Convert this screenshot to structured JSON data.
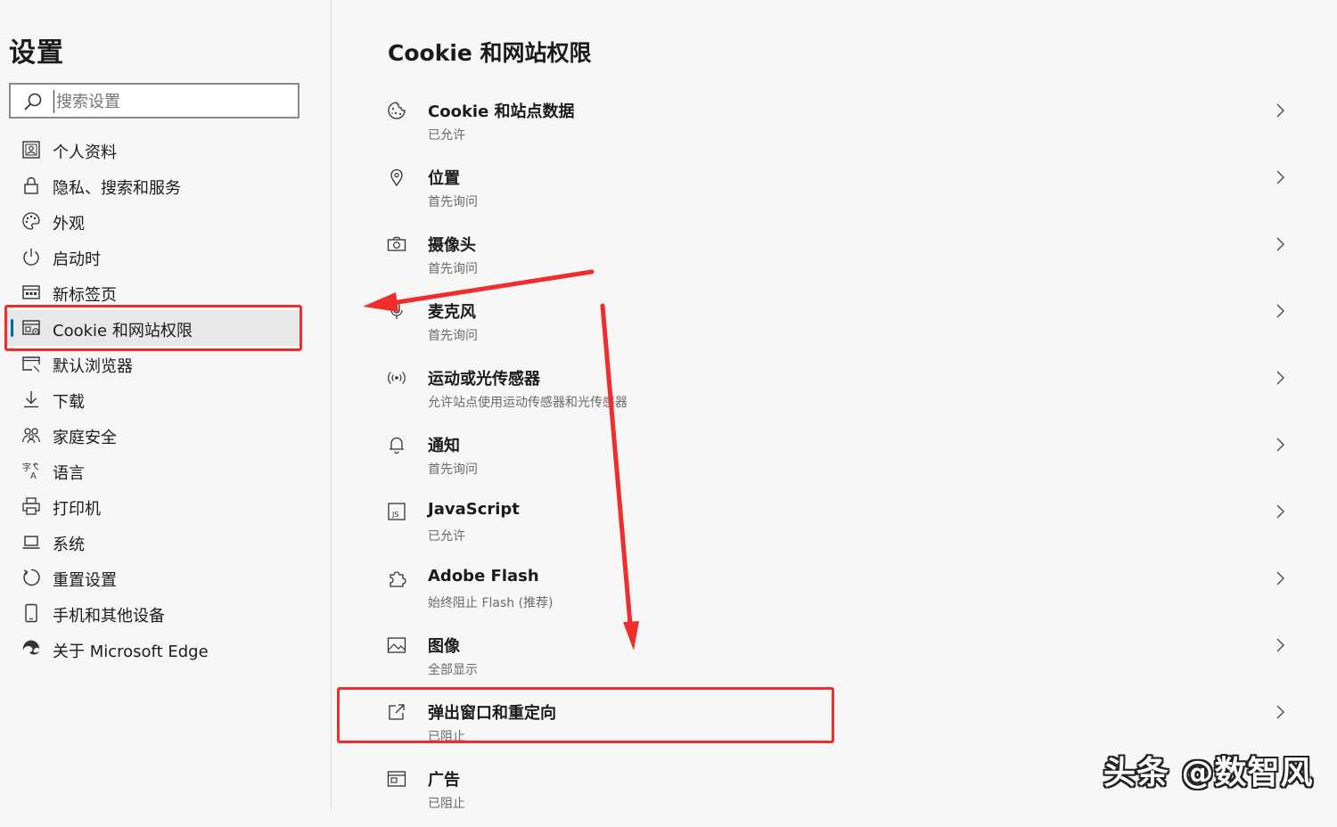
{
  "sidebar": {
    "title": "设置",
    "search_placeholder": "搜索设置",
    "items": [
      {
        "label": "个人资料",
        "icon": "profile-icon"
      },
      {
        "label": "隐私、搜索和服务",
        "icon": "lock-icon"
      },
      {
        "label": "外观",
        "icon": "palette-icon"
      },
      {
        "label": "启动时",
        "icon": "power-icon"
      },
      {
        "label": "新标签页",
        "icon": "new-tab-icon"
      },
      {
        "label": "Cookie 和网站权限",
        "icon": "site-permissions-icon",
        "active": true
      },
      {
        "label": "默认浏览器",
        "icon": "default-browser-icon"
      },
      {
        "label": "下载",
        "icon": "download-icon"
      },
      {
        "label": "家庭安全",
        "icon": "family-icon"
      },
      {
        "label": "语言",
        "icon": "language-icon"
      },
      {
        "label": "打印机",
        "icon": "printer-icon"
      },
      {
        "label": "系统",
        "icon": "system-icon"
      },
      {
        "label": "重置设置",
        "icon": "reset-icon"
      },
      {
        "label": "手机和其他设备",
        "icon": "phone-icon"
      },
      {
        "label": "关于 Microsoft Edge",
        "icon": "edge-logo-icon"
      }
    ]
  },
  "main": {
    "title": "Cookie 和网站权限",
    "rows": [
      {
        "title": "Cookie 和站点数据",
        "sub": "已允许",
        "icon": "cookie-icon"
      },
      {
        "title": "位置",
        "sub": "首先询问",
        "icon": "location-icon"
      },
      {
        "title": "摄像头",
        "sub": "首先询问",
        "icon": "camera-icon"
      },
      {
        "title": "麦克风",
        "sub": "首先询问",
        "icon": "microphone-icon"
      },
      {
        "title": "运动或光传感器",
        "sub": "允许站点使用运动传感器和光传感器",
        "icon": "sensor-icon"
      },
      {
        "title": "通知",
        "sub": "首先询问",
        "icon": "bell-icon"
      },
      {
        "title": "JavaScript",
        "sub": "已允许",
        "icon": "javascript-icon"
      },
      {
        "title": "Adobe Flash",
        "sub": "始终阻止 Flash (推荐)",
        "icon": "puzzle-icon"
      },
      {
        "title": "图像",
        "sub": "全部显示",
        "icon": "image-icon"
      },
      {
        "title": "弹出窗口和重定向",
        "sub": "已阻止",
        "icon": "popup-icon"
      },
      {
        "title": "广告",
        "sub": "已阻止",
        "icon": "ads-icon"
      }
    ]
  },
  "watermark": "头条 @数智风",
  "colors": {
    "annotation": "#f02d2d",
    "accent": "#0067c0"
  }
}
